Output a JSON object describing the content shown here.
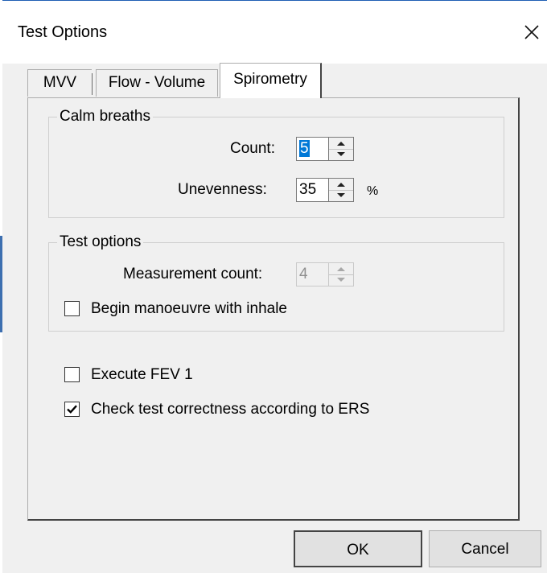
{
  "window": {
    "title": "Test Options",
    "close_icon": "close-icon"
  },
  "tabs": [
    {
      "label": "MVV",
      "selected": false
    },
    {
      "label": "Flow - Volume",
      "selected": false
    },
    {
      "label": "Spirometry",
      "selected": true
    }
  ],
  "calm_breaths": {
    "title": "Calm breaths",
    "count_label": "Count:",
    "count_value": "5",
    "unevenness_label": "Unevenness:",
    "unevenness_value": "35",
    "unevenness_unit": "%"
  },
  "test_options": {
    "title": "Test options",
    "measurement_count_label": "Measurement count:",
    "measurement_count_value": "4",
    "measurement_count_enabled": false,
    "begin_inhale_label": "Begin manoeuvre with inhale",
    "begin_inhale_checked": false
  },
  "execute_fev1": {
    "label": "Execute FEV 1",
    "checked": false
  },
  "check_ers": {
    "label": "Check test correctness according to ERS",
    "checked": true
  },
  "buttons": {
    "ok": "OK",
    "cancel": "Cancel"
  },
  "colors": {
    "accent_selection": "#0078d7",
    "dialog_bg": "#f0f0f0"
  }
}
